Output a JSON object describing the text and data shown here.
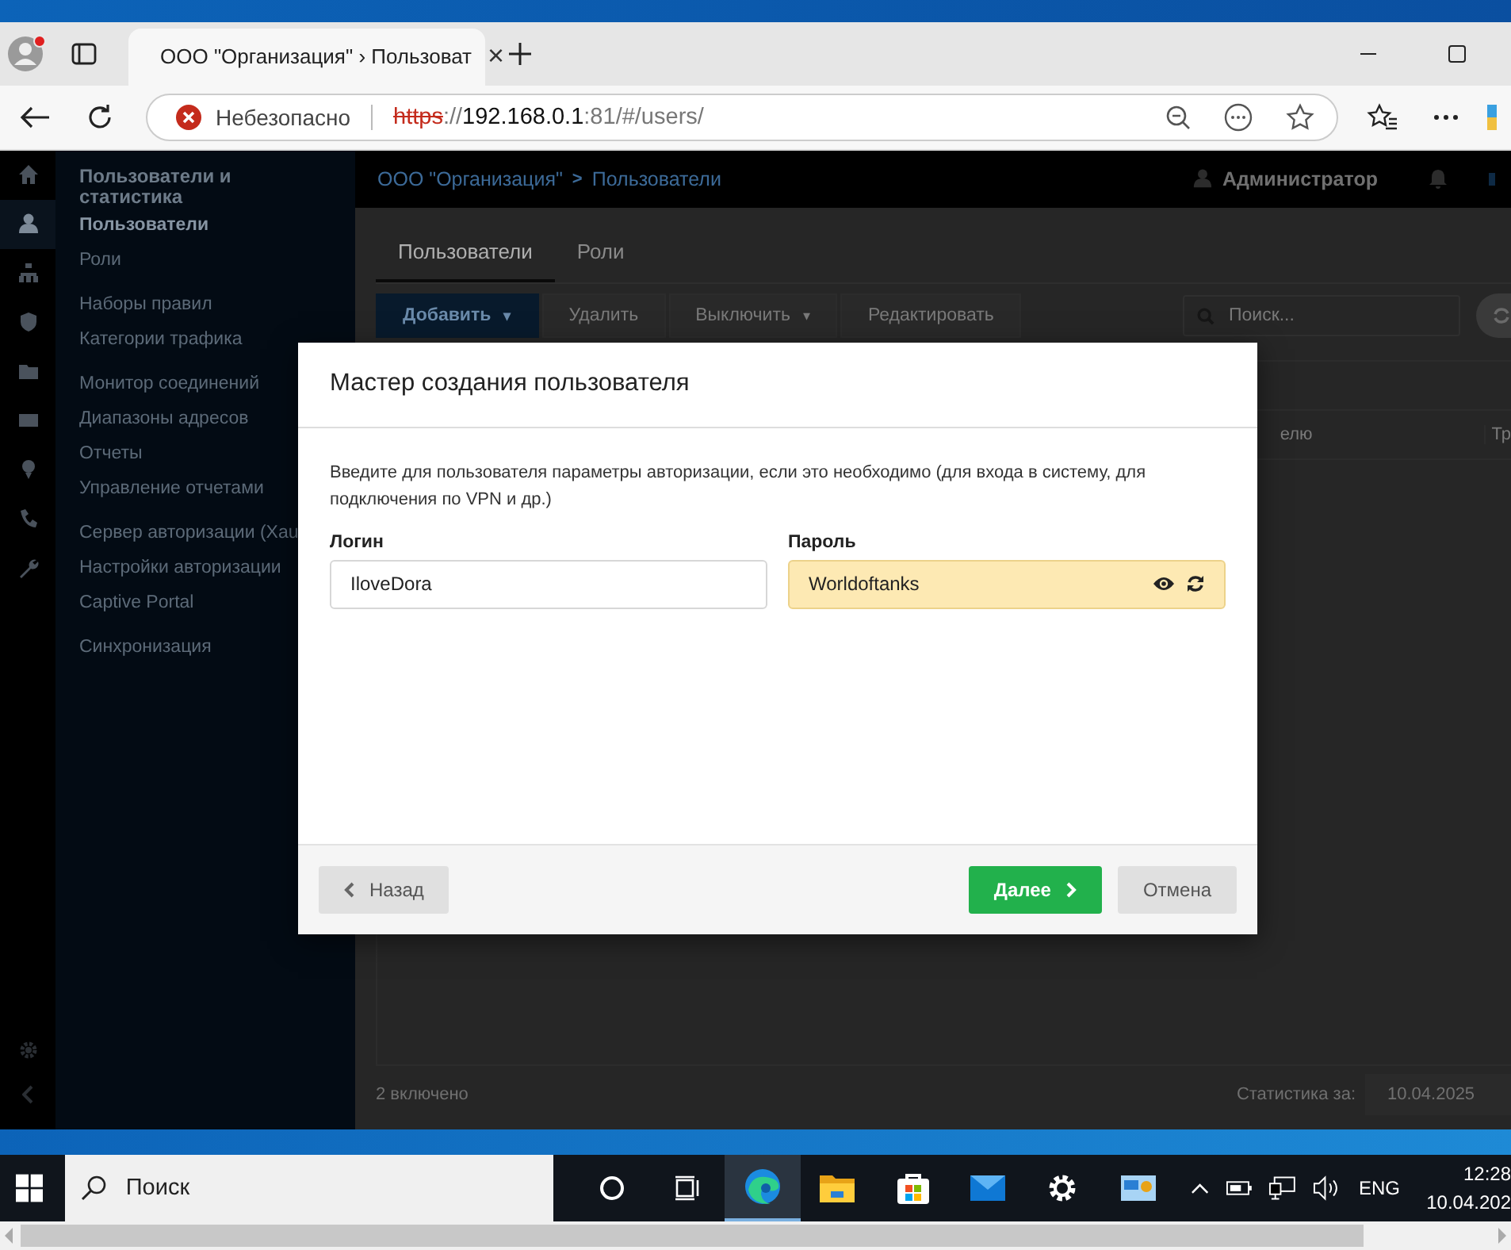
{
  "browser": {
    "tab": {
      "title": "ООО \"Организация\" › Пользоват",
      "close": "×"
    },
    "address": {
      "security": "Небезопасно",
      "url_parts": [
        {
          "text": "https",
          "kind": "scheme"
        },
        {
          "text": "://",
          "kind": "plain"
        },
        {
          "text": "192.168.0.1",
          "kind": "host"
        },
        {
          "text": ":81/#/users/",
          "kind": "plain"
        }
      ]
    }
  },
  "rail": {
    "items": [
      {
        "kind": "home",
        "selected": false
      },
      {
        "kind": "user",
        "selected": true
      },
      {
        "kind": "sitemap",
        "selected": false
      },
      {
        "kind": "shield",
        "selected": false
      },
      {
        "kind": "folder",
        "selected": false
      },
      {
        "kind": "envelope",
        "selected": false
      },
      {
        "kind": "pin",
        "selected": false
      },
      {
        "kind": "phone",
        "selected": false
      },
      {
        "kind": "wrench",
        "selected": false
      }
    ]
  },
  "sidebar": {
    "title": "Пользователи и статистика",
    "groups": [
      [
        {
          "label": "Пользователи",
          "selected": true
        },
        {
          "label": "Роли",
          "selected": false
        }
      ],
      [
        {
          "label": "Наборы правил",
          "selected": false
        },
        {
          "label": "Категории трафика",
          "selected": false
        }
      ],
      [
        {
          "label": "Монитор соединений",
          "selected": false
        },
        {
          "label": "Диапазоны адресов",
          "selected": false
        },
        {
          "label": "Отчеты",
          "selected": false
        },
        {
          "label": "Управление отчетами",
          "selected": false
        }
      ],
      [
        {
          "label": "Сервер авторизации (Xau",
          "selected": false
        },
        {
          "label": "Настройки авторизации",
          "selected": false
        },
        {
          "label": "Captive Portal",
          "selected": false
        }
      ],
      [
        {
          "label": "Синхронизация",
          "selected": false
        }
      ]
    ]
  },
  "header": {
    "breadcrumb": [
      "ООО \"Организация\"",
      "Пользователи"
    ],
    "separator": ">",
    "user": "Администратор"
  },
  "tabs": [
    {
      "label": "Пользователи",
      "selected": true
    },
    {
      "label": "Роли",
      "selected": false
    }
  ],
  "toolbar": {
    "buttons": [
      {
        "label": "Добавить",
        "kind": "primary",
        "caret": "▾"
      },
      {
        "label": "Удалить",
        "kind": "plain"
      },
      {
        "label": "Выключить",
        "kind": "dropdown",
        "caret": "▾"
      },
      {
        "label": "Редактировать",
        "kind": "plain"
      }
    ],
    "search": {
      "placeholder": "Поиск..."
    }
  },
  "table": {
    "columns": [
      {
        "column_1": "елю"
      },
      {
        "column_2": "Тр"
      }
    ]
  },
  "footer": {
    "count": "2 включено",
    "stats_label": "Статистика за:",
    "date": "10.04.2025"
  },
  "dialog": {
    "title": "Мастер создания пользователя",
    "description": "Введите для пользователя параметры авторизации, если это необходимо (для входа в систему, для подключения по VPN и др.)",
    "login": {
      "label": "Логин",
      "value": "IloveDora"
    },
    "password": {
      "label": "Пароль",
      "value": "Worldoftanks"
    },
    "buttons": [
      {
        "label": "Назад",
        "kind": "back"
      },
      {
        "label": "Далее",
        "kind": "next"
      },
      {
        "label": "Отмена",
        "kind": "cancel"
      }
    ]
  },
  "taskbar": {
    "search": "Поиск",
    "apps": [
      {
        "kind": "cortana",
        "active": false
      },
      {
        "kind": "taskview",
        "active": false
      },
      {
        "kind": "edge",
        "active": true
      },
      {
        "kind": "explorer",
        "active": false
      },
      {
        "kind": "store",
        "active": false
      },
      {
        "kind": "mail",
        "active": false
      },
      {
        "kind": "settings",
        "active": false
      },
      {
        "kind": "panel",
        "active": false
      }
    ],
    "language": "ENG",
    "time": "12:28",
    "date": "10.04.202"
  }
}
